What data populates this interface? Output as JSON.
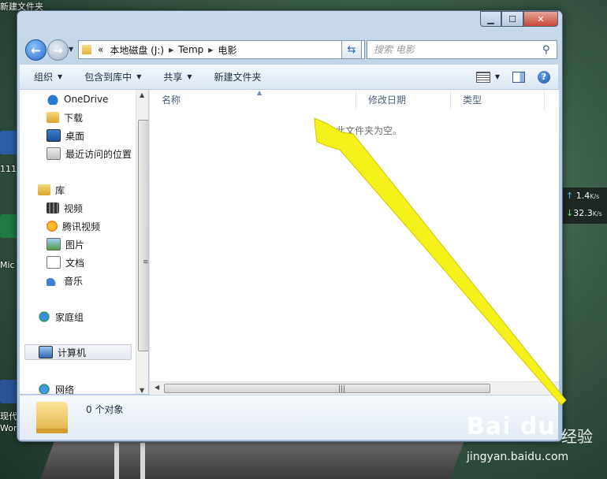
{
  "desktop": {
    "top_title": "新建文件夹",
    "left_labels": [
      "111",
      "Mic",
      "现代",
      "Wor"
    ],
    "net_speed": {
      "up": "1.4",
      "down": "32.3",
      "unit": "K/s"
    }
  },
  "window": {
    "breadcrumb": {
      "overflow": "«",
      "items": [
        "本地磁盘 (J:)",
        "Temp",
        "电影"
      ]
    },
    "search": {
      "placeholder": "搜索 电影"
    },
    "toolbar": {
      "organize": "组织",
      "include_in_library": "包含到库中",
      "share": "共享",
      "new_folder": "新建文件夹"
    },
    "nav_pane": {
      "favorites": [
        "OneDrive",
        "下载",
        "桌面",
        "最近访问的位置"
      ],
      "library_title": "库",
      "libraries": [
        "视频",
        "腾讯视频",
        "图片",
        "文档",
        "音乐"
      ],
      "homegroup": "家庭组",
      "computer": "计算机",
      "network": "网络"
    },
    "columns": [
      "名称",
      "修改日期",
      "类型"
    ],
    "empty_message": "此文件夹为空。",
    "details": {
      "item_count": "0 个对象"
    }
  },
  "watermark": {
    "logo": "Bai du",
    "sub": "经验",
    "url": "jingyan.baidu.com"
  },
  "colors": {
    "arrow": "#f4f11a",
    "accent": "#2a6ac7"
  }
}
